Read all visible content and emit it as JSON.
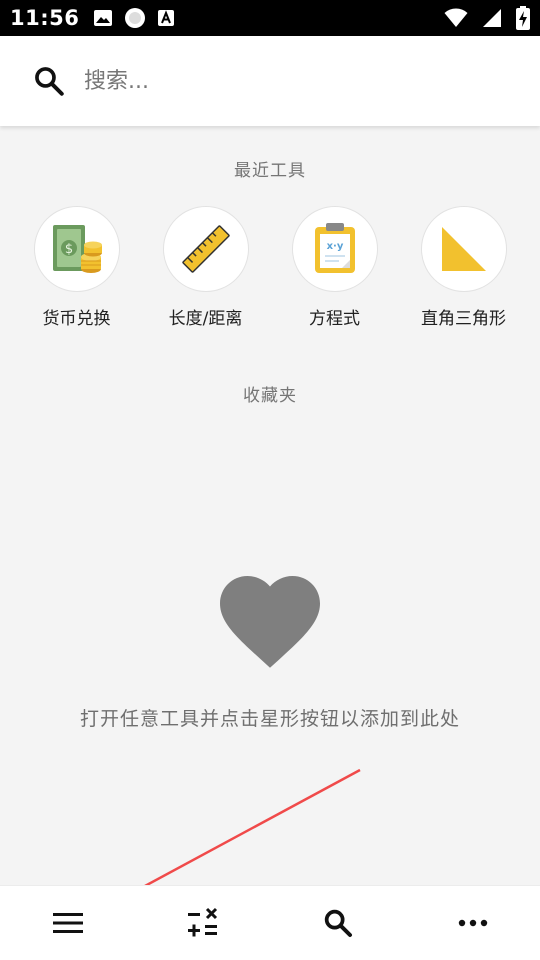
{
  "status_bar": {
    "time": "11:56",
    "left_icons": [
      "image-icon",
      "circle-app-icon",
      "text-a-icon"
    ],
    "right_icons": [
      "wifi-icon",
      "signal-icon",
      "battery-charging-icon"
    ]
  },
  "search": {
    "placeholder": "搜索..."
  },
  "recent": {
    "title": "最近工具",
    "tools": [
      {
        "label": "货币兑换",
        "icon": "currency-exchange-icon"
      },
      {
        "label": "长度/距离",
        "icon": "ruler-icon"
      },
      {
        "label": "方程式",
        "icon": "equation-clipboard-icon"
      },
      {
        "label": "直角三角形",
        "icon": "right-triangle-icon"
      }
    ]
  },
  "favorites": {
    "title": "收藏夹",
    "empty_icon": "heart-icon",
    "empty_message": "打开任意工具并点击星形按钮以添加到此处"
  },
  "bottom_nav": {
    "items": [
      "menu-icon",
      "calculator-icon",
      "search-icon",
      "more-icon"
    ]
  },
  "colors": {
    "background": "#f4f4f4",
    "accent_yellow": "#f2c12e",
    "annotation_arrow": "#f04a4a"
  }
}
